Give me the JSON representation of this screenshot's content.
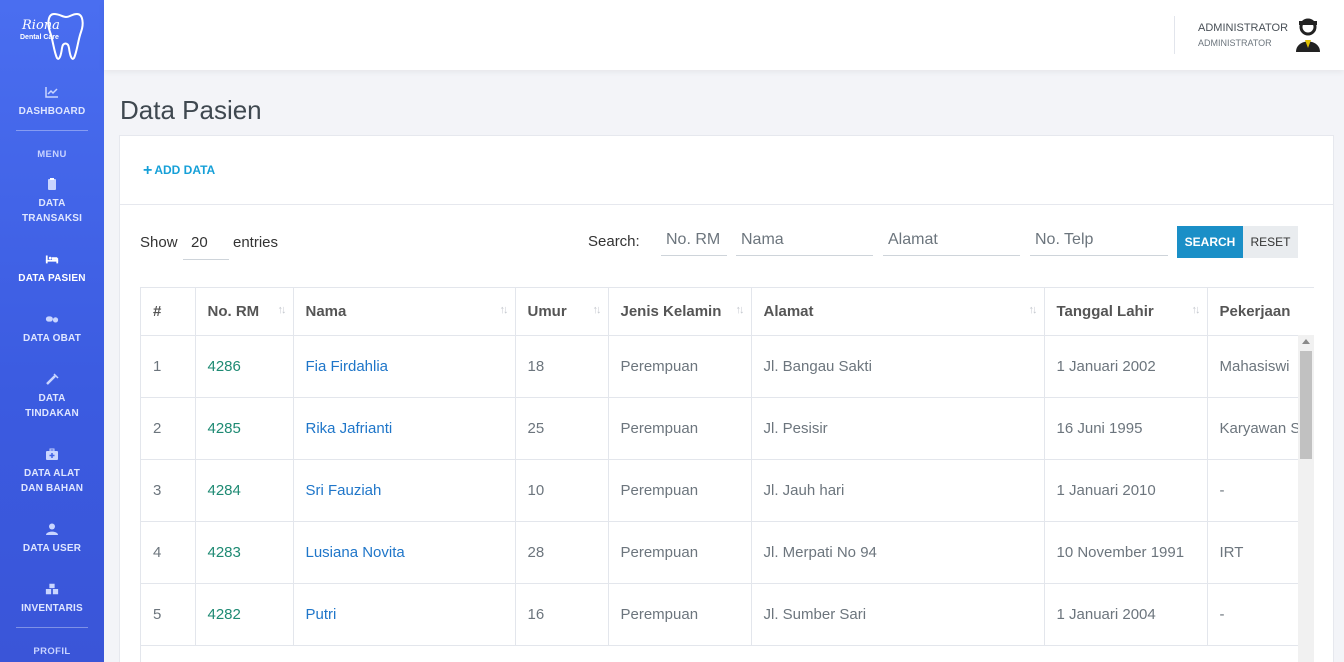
{
  "brand": {
    "name": "Riona",
    "sub": "Dental Care"
  },
  "sidebar": {
    "items": [
      {
        "label": "DASHBOARD",
        "icon": "chart-icon"
      },
      {
        "label": "DATA TRANSAKSI",
        "icon": "clipboard-icon"
      },
      {
        "label": "DATA PASIEN",
        "icon": "bed-icon"
      },
      {
        "label": "DATA OBAT",
        "icon": "pills-icon"
      },
      {
        "label": "DATA TINDAKAN",
        "icon": "syringe-icon"
      },
      {
        "label": "DATA ALAT DAN BAHAN",
        "icon": "medkit-icon"
      },
      {
        "label": "DATA USER",
        "icon": "user-icon"
      },
      {
        "label": "INVENTARIS",
        "icon": "boxes-icon"
      }
    ],
    "menu_heading": "MENU",
    "profil_heading": "PROFIL"
  },
  "header": {
    "user_name": "ADMINISTRATOR",
    "user_role": "ADMINISTRATOR"
  },
  "page": {
    "title": "Data Pasien",
    "add_label": "ADD DATA"
  },
  "controls": {
    "show_label": "Show",
    "entries_value": "20",
    "entries_label": "entries",
    "search_label": "Search:",
    "placeholders": {
      "rm": "No. RM",
      "nama": "Nama",
      "alamat": "Alamat",
      "telp": "No. Telp"
    },
    "search_button": "SEARCH",
    "reset_button": "RESET"
  },
  "table": {
    "columns": [
      "#",
      "No. RM",
      "Nama",
      "Umur",
      "Jenis Kelamin",
      "Alamat",
      "Tanggal Lahir",
      "Pekerjaan"
    ],
    "rows": [
      [
        "1",
        "4286",
        "Fia Firdahlia",
        "18",
        "Perempuan",
        "Jl. Bangau Sakti",
        "1 Januari 2002",
        "Mahasiswi"
      ],
      [
        "2",
        "4285",
        "Rika Jafrianti",
        "25",
        "Perempuan",
        "Jl. Pesisir",
        "16 Juni 1995",
        "Karyawan S"
      ],
      [
        "3",
        "4284",
        "Sri Fauziah",
        "10",
        "Perempuan",
        "Jl. Jauh hari",
        "1 Januari 2010",
        "-"
      ],
      [
        "4",
        "4283",
        "Lusiana Novita",
        "28",
        "Perempuan",
        "Jl. Merpati No 94",
        "10 November 1991",
        "IRT"
      ],
      [
        "5",
        "4282",
        "Putri",
        "16",
        "Perempuan",
        "Jl. Sumber Sari",
        "1 Januari 2004",
        "-"
      ]
    ]
  },
  "colors": {
    "sidebar": "#3f62e6",
    "accent": "#1a8fc7",
    "rm_text": "#1e8a73",
    "name_link": "#1f76c9"
  }
}
